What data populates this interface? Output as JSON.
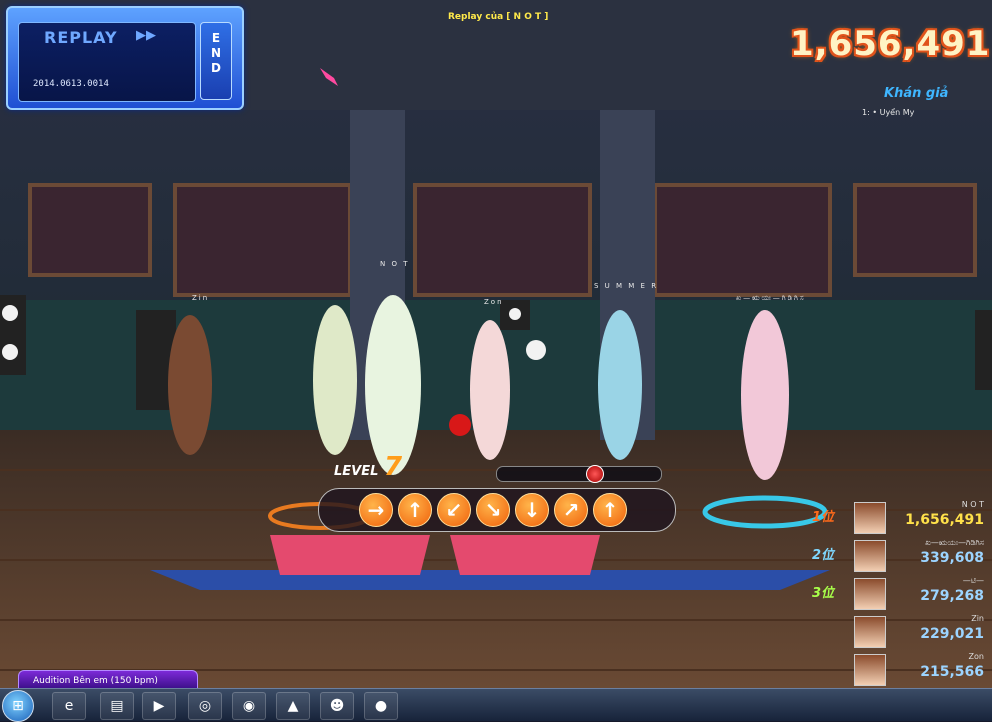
{
  "replay": {
    "title": "REPLAY",
    "play_icon": "double-right-triangle",
    "date": "2014.0613.0014",
    "end_label": [
      "E",
      "N",
      "D"
    ]
  },
  "replay_of": "Replay của [ N O T ]",
  "total_score": "1,656,491",
  "audience": {
    "title": "Khán giả",
    "items": [
      "1: • Uyển My"
    ]
  },
  "player_tags": [
    "Zin",
    "N O T",
    "Zon",
    "S U M M E R",
    "ಖ—ಋಯಃ—ಗಿಡಿಗಿಸ"
  ],
  "level": {
    "label": "LEVEL",
    "value": "7"
  },
  "song_progress": 0.6,
  "arrows": [
    "→",
    "↑",
    "↙",
    "↘",
    "↓",
    "↗",
    "↑"
  ],
  "ranking": [
    {
      "rank": "1位",
      "name": "N O T",
      "score": "1,656,491",
      "color": "#ffe14a",
      "badge_color": "#ff6a1a"
    },
    {
      "rank": "2位",
      "name": "ಖ—ಋಯಃ—ಗಿಡಿಗಿಸ",
      "score": "339,608",
      "color": "#9cd4ff",
      "badge_color": "#7fd8ff"
    },
    {
      "rank": "3位",
      "name": "—ಟಿ—",
      "score": "279,268",
      "color": "#9cd4ff",
      "badge_color": "#a8ff4a"
    },
    {
      "rank": "",
      "name": "Zin",
      "score": "229,021",
      "color": "#9cd4ff",
      "badge_color": ""
    },
    {
      "rank": "",
      "name": "Zon",
      "score": "215,566",
      "color": "#9cd4ff",
      "badge_color": ""
    }
  ],
  "tooltip": "Audition Bên em (150 bpm)",
  "taskbar": {
    "start_icon": "windows-start-icon",
    "icons": [
      "ie-icon",
      "explorer-icon",
      "media-player-icon",
      "app-icon",
      "chrome-icon",
      "audition-icon",
      "avatar-app-icon",
      "record-icon"
    ]
  },
  "colors": {
    "accent": "#ff9d1a",
    "replay_blue": "#1f4fd3",
    "score_outline": "#e0531b"
  }
}
